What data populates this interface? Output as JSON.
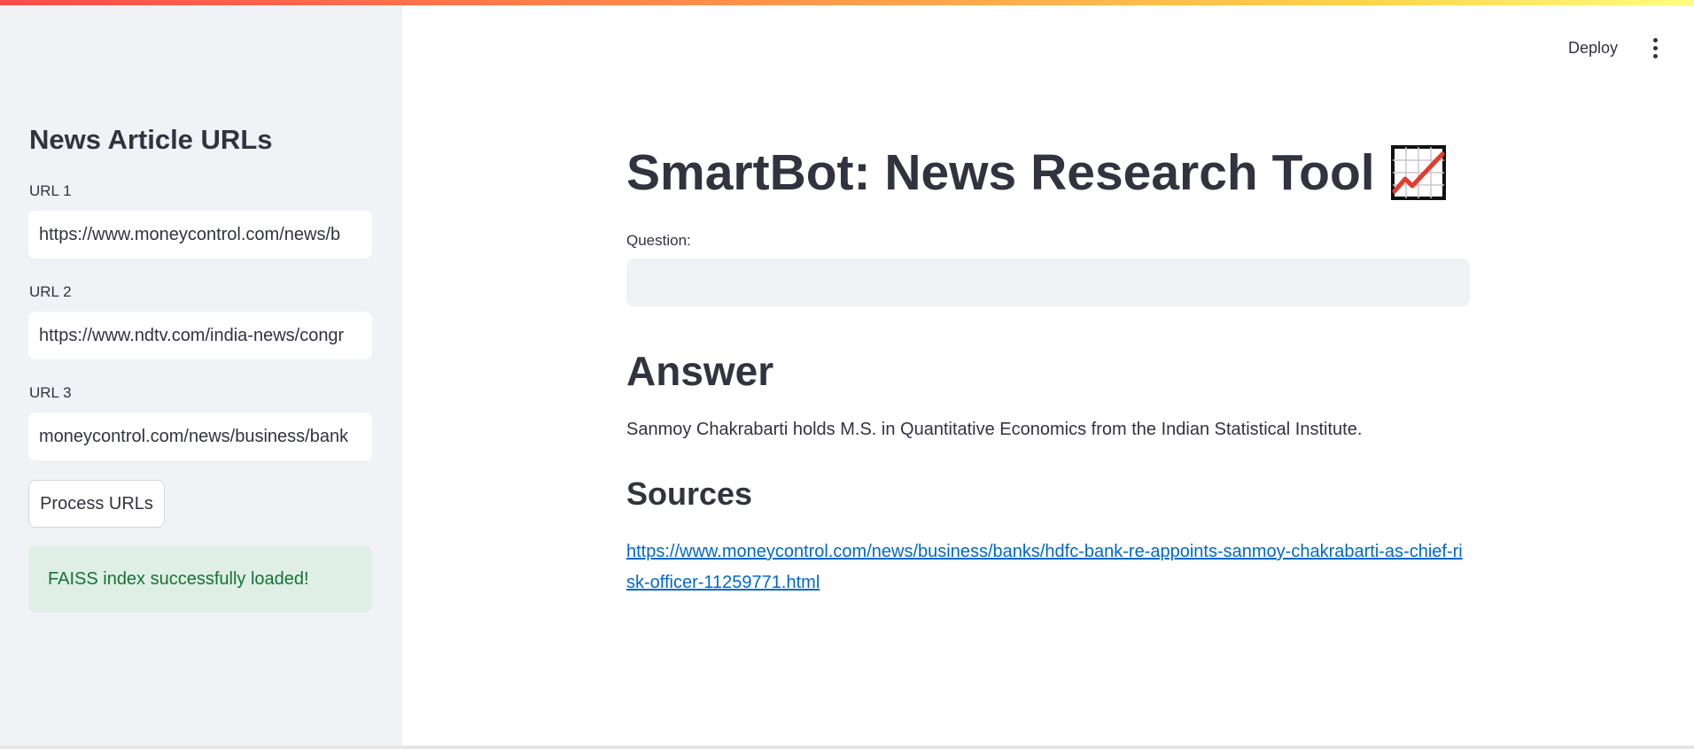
{
  "sidebar": {
    "heading": "News Article URLs",
    "urls": [
      {
        "label": "URL 1",
        "value": "https://www.moneycontrol.com/news/b"
      },
      {
        "label": "URL 2",
        "value": "https://www.ndtv.com/india-news/congr"
      },
      {
        "label": "URL 3",
        "value": "moneycontrol.com/news/business/bank"
      }
    ],
    "process_button": "Process URLs",
    "status_message": "FAISS index successfully loaded!"
  },
  "header": {
    "deploy_label": "Deploy",
    "menu_icon": "kebab-menu-icon"
  },
  "main": {
    "title": "SmartBot: News Research Tool",
    "title_icon": "chart-increasing-icon",
    "question_label": "Question:",
    "question_value": "",
    "answer_heading": "Answer",
    "answer_text": "Sanmoy Chakrabarti holds M.S. in Quantitative Economics from the Indian Statistical Institute.",
    "sources_heading": "Sources",
    "source_link": "https://www.moneycontrol.com/news/business/banks/hdfc-bank-re-appoints-sanmoy-chakrabarti-as-chief-risk-officer-11259771.html"
  },
  "colors": {
    "sidebar_bg": "#f0f2f6",
    "success_bg": "#dfefe6",
    "success_text": "#177233",
    "link": "#0068c9",
    "text": "#31333f"
  }
}
